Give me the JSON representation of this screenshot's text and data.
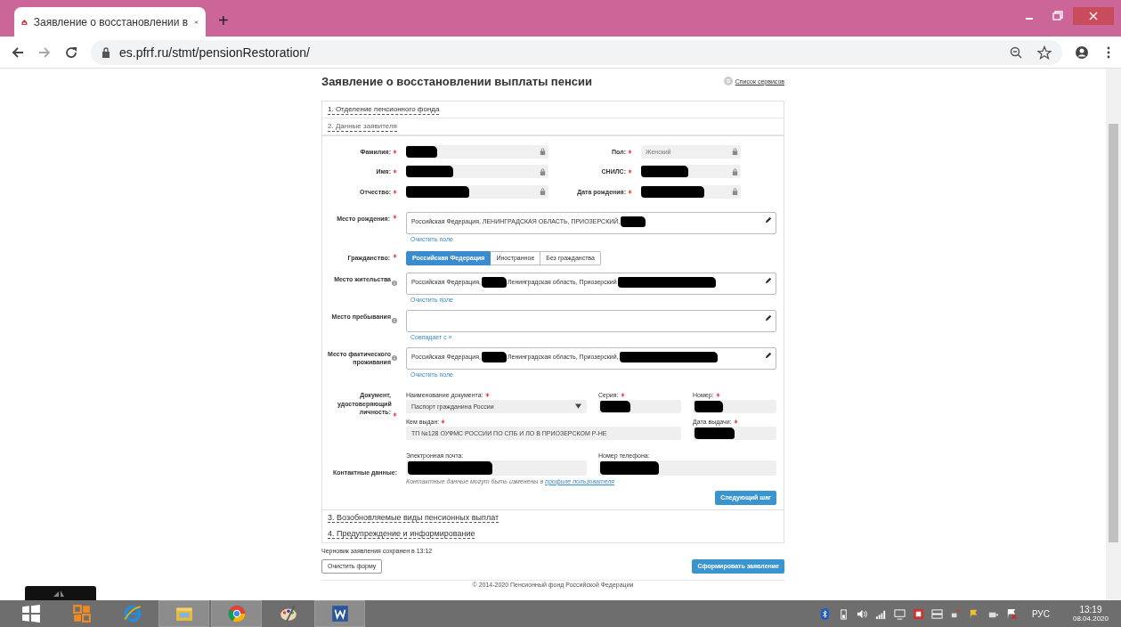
{
  "browser": {
    "tab_title": "Заявление о восстановлении в",
    "new_tab": "+",
    "url": "es.pfrf.ru/stmt/pensionRestoration/"
  },
  "page": {
    "title": "Заявление о восстановлении выплаты пенсии",
    "services_link": "Список сервисов",
    "sections": [
      {
        "label": "1. Отделение пенсионного фонда",
        "expanded": false
      },
      {
        "label": "2. Данные заявителя",
        "expanded": true
      },
      {
        "label": "3. Возобновляемые виды пенсионных выплат",
        "expanded": false
      },
      {
        "label": "4. Предупреждение и информирование",
        "expanded": false
      }
    ],
    "locked_fields": [
      {
        "label": "Фамилия:",
        "required": true,
        "redacted": true
      },
      {
        "label": "Пол:",
        "required": true,
        "value": "Женский",
        "redacted": false
      },
      {
        "label": "Имя:",
        "required": true,
        "redacted": true
      },
      {
        "label": "СНИЛС:",
        "required": true,
        "redacted": true
      },
      {
        "label": "Отчество:",
        "required": true,
        "redacted": true
      },
      {
        "label": "Дата рождения:",
        "required": true,
        "redacted": true
      }
    ],
    "birthplace": {
      "label": "Место рождения:",
      "required": true,
      "parts": [
        {
          "kind": "text",
          "text": "Российская Федерация, ЛЕНИНГРАДСКАЯ ОБЛАСТЬ, ПРИОЗЕРСКИЙ,"
        },
        {
          "kind": "redaction"
        }
      ],
      "link": "Очистить поле"
    },
    "citizenship": {
      "label": "Гражданство:",
      "required": true,
      "options": [
        {
          "label": "Российская Федерация",
          "selected": true
        },
        {
          "label": "Иностранное",
          "selected": false
        },
        {
          "label": "Без гражданства",
          "selected": false
        }
      ]
    },
    "addresses": [
      {
        "label": "Место жительства",
        "info": true,
        "parts": [
          {
            "kind": "text",
            "text": "Российская Федерация,"
          },
          {
            "kind": "redaction"
          },
          {
            "kind": "text",
            "text": "Ленинградская область, Приозерский"
          },
          {
            "kind": "redaction"
          }
        ],
        "link": "Очистить поле"
      },
      {
        "label": "Место пребывания",
        "info": true,
        "link": "Совпадает с »"
      },
      {
        "label": "Место фактического проживания",
        "info": true,
        "parts": [
          {
            "kind": "text",
            "text": "Российская Федерация,"
          },
          {
            "kind": "redaction"
          },
          {
            "kind": "text",
            "text": "Ленинградская область, Приозерский,"
          },
          {
            "kind": "redaction"
          }
        ],
        "link": "Очистить поле"
      }
    ],
    "document": {
      "label": "Документ, удостоверяющий личность:",
      "required": true,
      "name_label": "Наименование документа:",
      "name_value": "Паспорт гражданина России",
      "series_label": "Серия:",
      "number_label": "Номер:",
      "issuer_label": "Кем выдан:",
      "issuer_value": "ТП №128 ОУФМС РОССИИ ПО СПБ И ЛО В ПРИОЗЕРСКОМ Р-НЕ",
      "date_label": "Дата выдачи:"
    },
    "contacts": {
      "label": "Контактные данные:",
      "email_label": "Электронная почта:",
      "phone_label": "Номер телефона:",
      "note": "Контактные данные могут быть изменены в",
      "note_link": "профиле пользователя"
    },
    "next_button": "Следующий шаг",
    "draft_note": "Черновик заявления сохранен в 13:12",
    "clear_button": "Очистить форму",
    "submit_button": "Сформировать заявление",
    "footer": "© 2014-2020 Пенсионный фонд Российской Федерации"
  },
  "taskbar": {
    "apps": [
      {
        "kind": "start",
        "selected": false
      },
      {
        "kind": "office",
        "selected": false
      },
      {
        "kind": "ie",
        "selected": false
      },
      {
        "kind": "explorer",
        "selected": true
      },
      {
        "kind": "chrome",
        "selected": true
      },
      {
        "kind": "paint",
        "selected": false
      },
      {
        "kind": "word",
        "selected": true
      }
    ],
    "language": "РУС",
    "time": "13:19",
    "date": "08.04.2020"
  }
}
